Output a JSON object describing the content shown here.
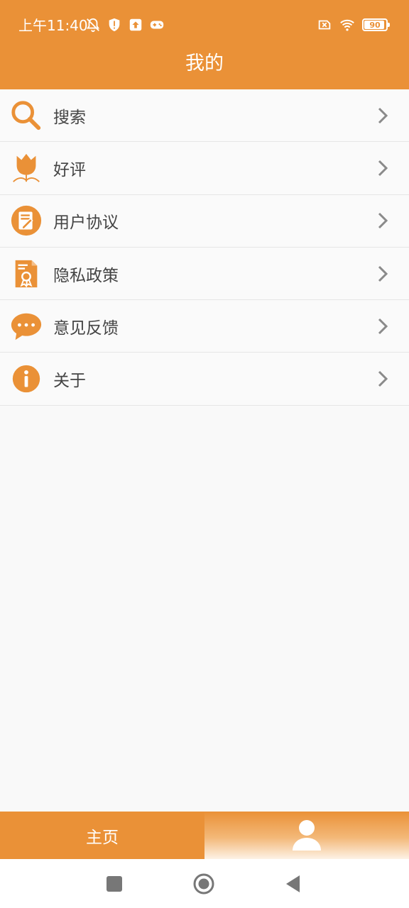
{
  "status_bar": {
    "time": "上午11:40",
    "battery": "90"
  },
  "header": {
    "title": "我的"
  },
  "menu": {
    "items": [
      {
        "label": "搜索",
        "icon": "search-icon"
      },
      {
        "label": "好评",
        "icon": "tulip-icon"
      },
      {
        "label": "用户协议",
        "icon": "agreement-icon"
      },
      {
        "label": "隐私政策",
        "icon": "privacy-certificate-icon"
      },
      {
        "label": "意见反馈",
        "icon": "chat-bubble-icon"
      },
      {
        "label": "关于",
        "icon": "info-icon"
      }
    ]
  },
  "tabs": {
    "home_label": "主页",
    "mine_icon": "person-icon"
  },
  "colors": {
    "accent": "#ea9137",
    "text": "#444444",
    "chevron": "#8a8a8a"
  }
}
